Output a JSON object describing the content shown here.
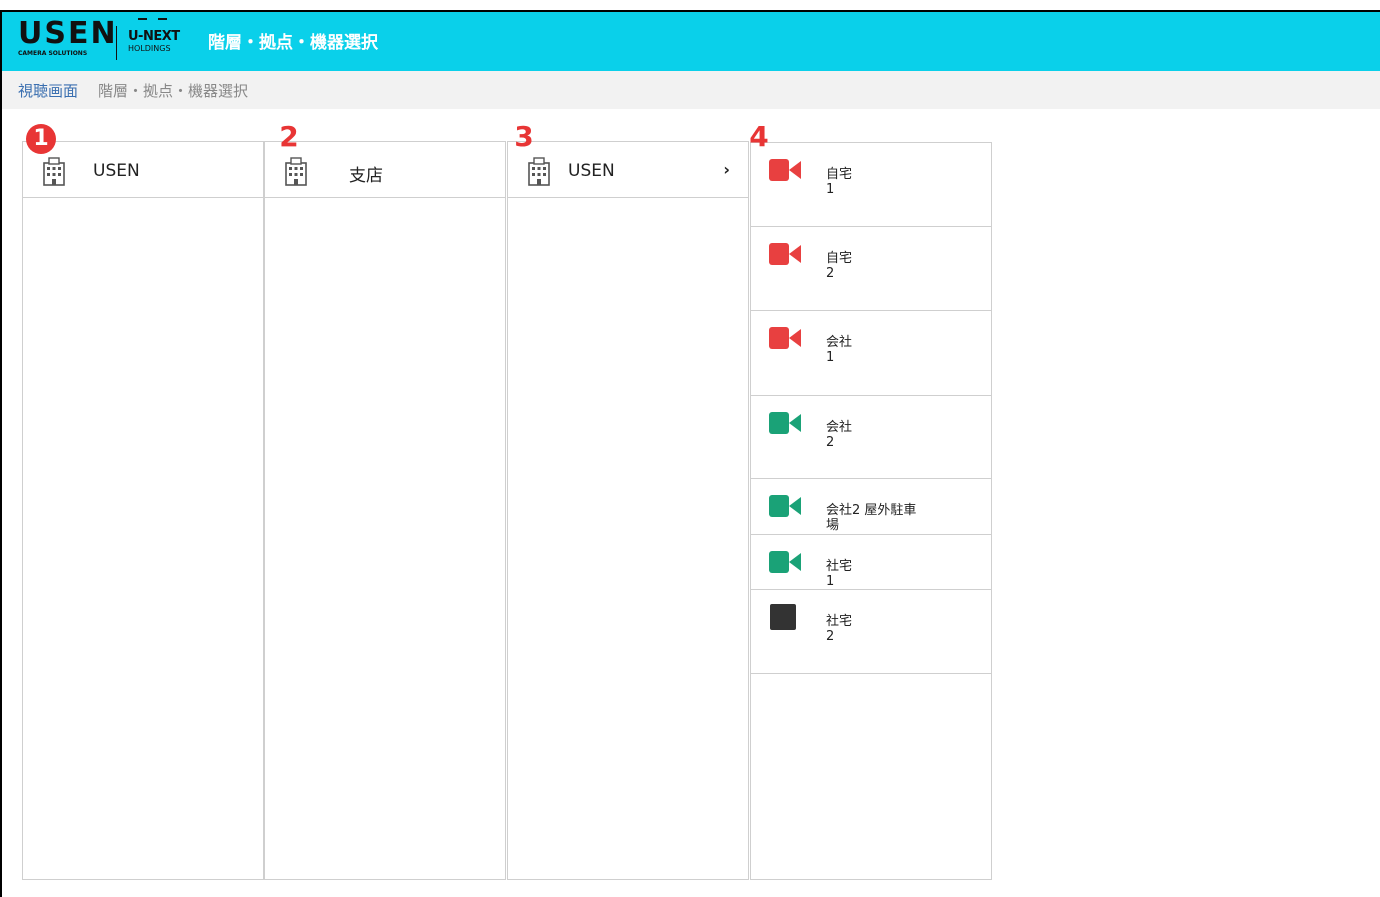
{
  "header": {
    "logo_main": "USEN",
    "logo_sub": "CAMERA SOLUTIONS",
    "partner_main": "U-NEXT",
    "partner_sub": "HOLDINGS",
    "title": "階層・拠点・機器選択"
  },
  "breadcrumb": {
    "link": "視聴画面",
    "current": "階層・拠点・機器選択"
  },
  "badges": [
    "1",
    "2",
    "3",
    "4"
  ],
  "columns": [
    {
      "label": "USEN",
      "icon": "building-icon",
      "has_chevron": false
    },
    {
      "label": "支店",
      "icon": "building-icon",
      "has_chevron": false
    },
    {
      "label": "USEN",
      "icon": "building-icon",
      "has_chevron": true,
      "chevron": "›"
    }
  ],
  "devices": [
    {
      "name_line1": "自宅",
      "name_line2": "1",
      "icon": "camera-icon",
      "color": "#e84040"
    },
    {
      "name_line1": "自宅",
      "name_line2": "2",
      "icon": "camera-icon",
      "color": "#e84040"
    },
    {
      "name_line1": "会社",
      "name_line2": "1",
      "icon": "camera-icon",
      "color": "#e84040"
    },
    {
      "name_line1": "会社",
      "name_line2": "2",
      "icon": "camera-icon",
      "color": "#1aa277"
    },
    {
      "name_line1": "会社2 屋外駐車",
      "name_line2": "場",
      "icon": "camera-icon",
      "color": "#1aa277"
    },
    {
      "name_line1": "社宅",
      "name_line2": "1",
      "icon": "camera-icon",
      "color": "#1aa277"
    },
    {
      "name_line1": "社宅",
      "name_line2": "2",
      "icon": "square-icon",
      "color": "#333333"
    }
  ]
}
